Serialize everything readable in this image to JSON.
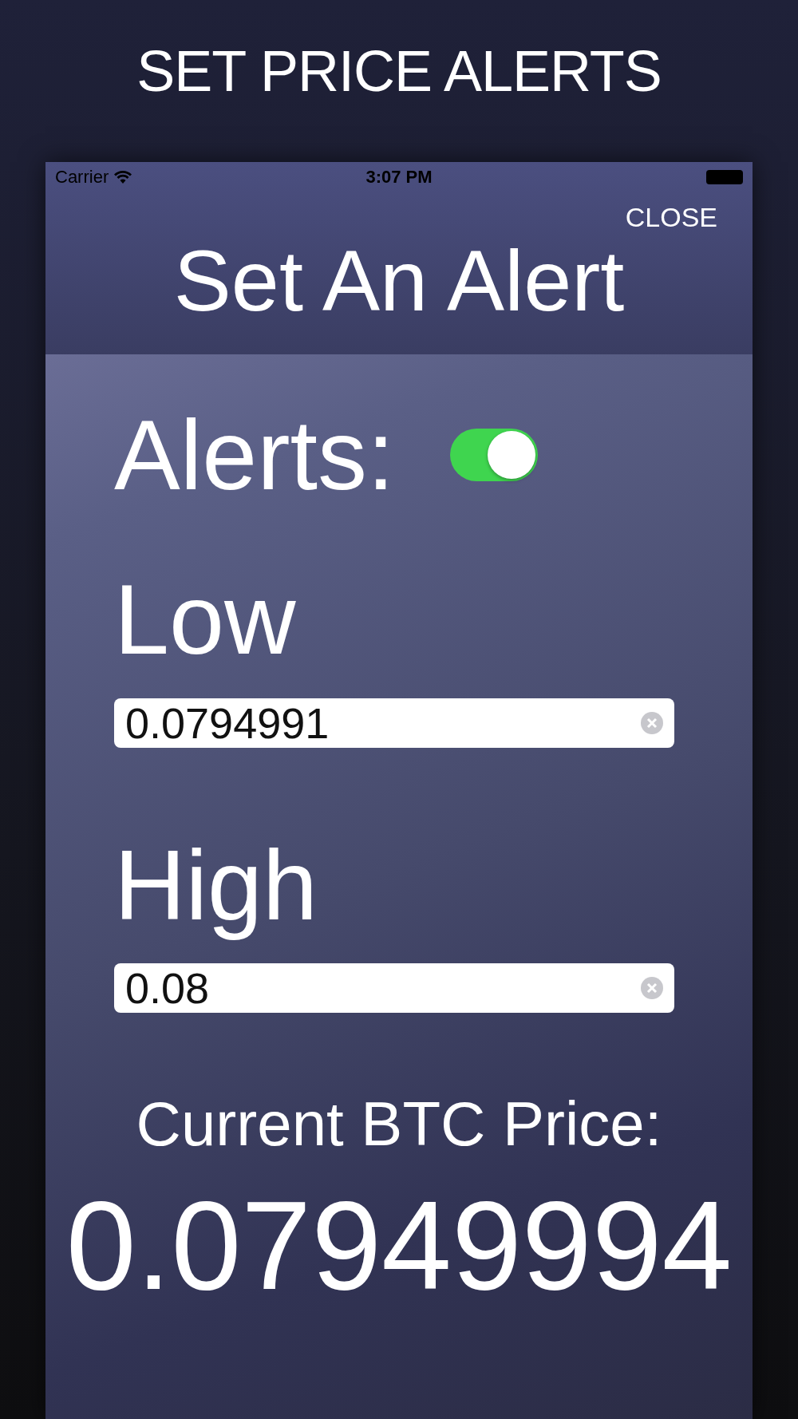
{
  "headline": "SET PRICE ALERTS",
  "status_bar": {
    "carrier": "Carrier",
    "time": "3:07 PM"
  },
  "header": {
    "close": "CLOSE",
    "title": "Set An Alert"
  },
  "alerts": {
    "label": "Alerts:",
    "on": true
  },
  "fields": [
    {
      "label": "Low",
      "value": "0.0794991"
    },
    {
      "label": "High",
      "value": "0.08"
    }
  ],
  "current": {
    "label": "Current BTC Price:",
    "value": "0.07949994"
  }
}
